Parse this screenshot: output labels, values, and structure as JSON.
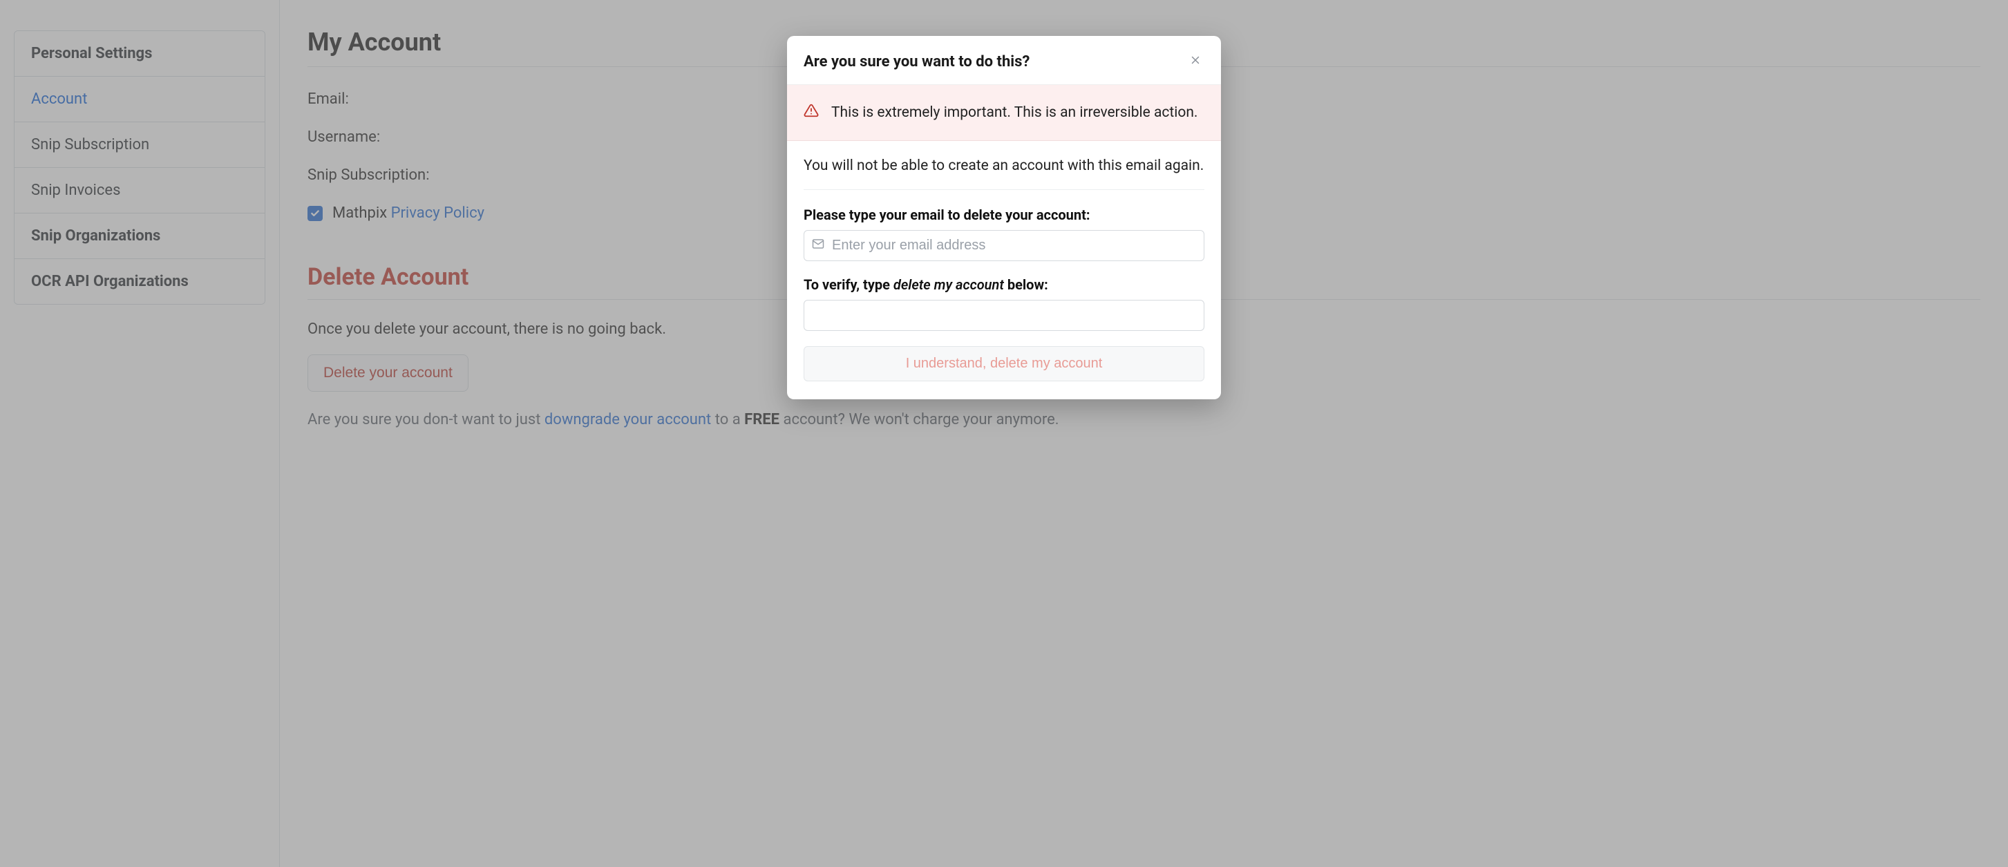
{
  "sidebar": {
    "items": [
      {
        "label": "Personal Settings",
        "header": true
      },
      {
        "label": "Account",
        "active": true
      },
      {
        "label": "Snip Subscription"
      },
      {
        "label": "Snip Invoices"
      },
      {
        "label": "Snip Organizations",
        "bold": true
      },
      {
        "label": "OCR API Organizations",
        "bold": true
      }
    ]
  },
  "main": {
    "title": "My Account",
    "email_label": "Email:",
    "username_label": "Username:",
    "snip_sub_label": "Snip Subscription:",
    "consent_prefix": "Mathpix",
    "privacy_link": "Privacy Policy",
    "delete_section_title": "Delete Account",
    "delete_warning": "Once you delete your account, there is no going back.",
    "delete_button": "Delete your account",
    "downgrade_prefix": "Are you sure you don-t want to just ",
    "downgrade_link": "downgrade your account",
    "downgrade_mid": " to a ",
    "downgrade_bold": "FREE",
    "downgrade_suffix": " account? We won't charge your anymore."
  },
  "modal": {
    "title": "Are you sure you want to do this?",
    "alert_text": "This is extremely important. This is an irreversible action.",
    "body_text": "You will not be able to create an account with this email again.",
    "email_label": "Please type your email to delete your account:",
    "email_placeholder": "Enter your email address",
    "verify_label_prefix": "To verify, type ",
    "verify_phrase": "delete my account",
    "verify_label_suffix": " below:",
    "confirm_button": "I understand, delete my account"
  }
}
